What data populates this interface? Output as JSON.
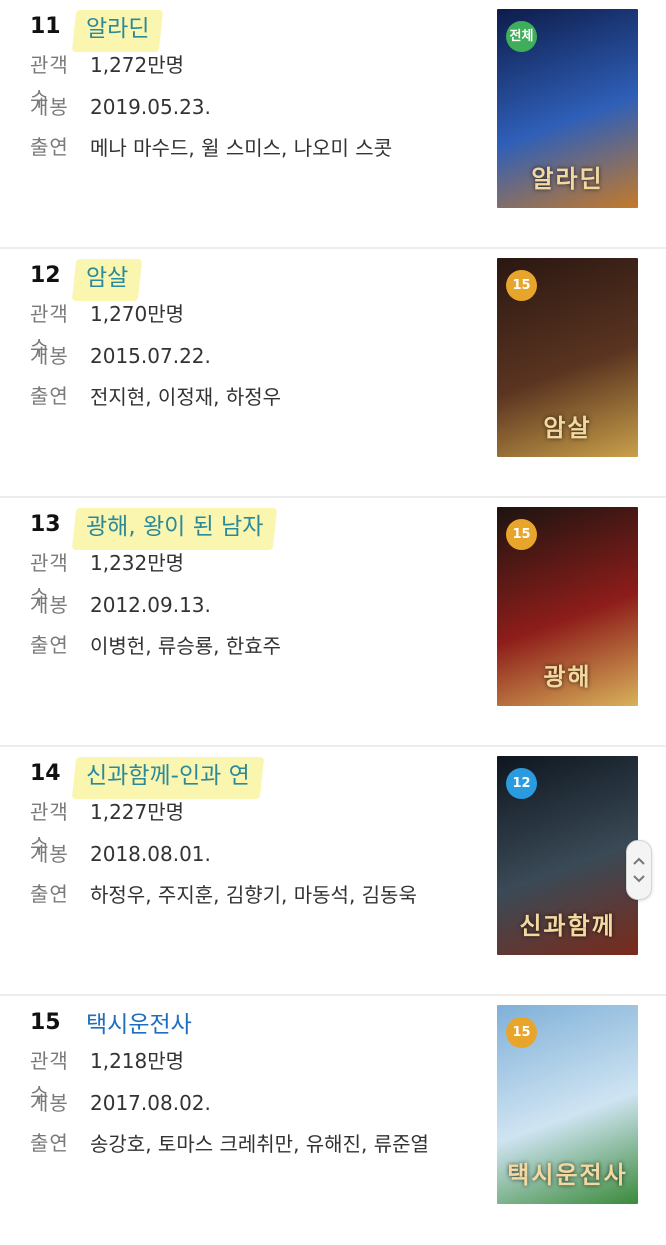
{
  "labels": {
    "audience": "관객수",
    "release": "개봉",
    "cast": "출연"
  },
  "movies": [
    {
      "rank": "11",
      "title": "알라딘",
      "highlighted": true,
      "audience": "1,272만명",
      "release": "2019.05.23.",
      "cast": "메나 마수드, 윌 스미스, 나오미 스콧",
      "rating": "전체",
      "rating_color": "#3fae5a",
      "poster_text": "알라딘",
      "poster_colors": [
        "#0d1c4a",
        "#2f5fb8",
        "#c47a2a"
      ]
    },
    {
      "rank": "12",
      "title": "암살",
      "highlighted": true,
      "audience": "1,270만명",
      "release": "2015.07.22.",
      "cast": "전지현, 이정재, 하정우",
      "rating": "15",
      "rating_color": "#e8a52c",
      "poster_text": "암살",
      "poster_colors": [
        "#2a1712",
        "#5a3420",
        "#c9a04a"
      ]
    },
    {
      "rank": "13",
      "title": "광해, 왕이 된 남자",
      "highlighted": true,
      "audience": "1,232만명",
      "release": "2012.09.13.",
      "cast": "이병헌, 류승룡, 한효주",
      "rating": "15",
      "rating_color": "#e8a52c",
      "poster_text": "광해",
      "poster_colors": [
        "#1b1410",
        "#8e1d1a",
        "#d8b25a"
      ]
    },
    {
      "rank": "14",
      "title": "신과함께-인과 연",
      "highlighted": true,
      "audience": "1,227만명",
      "release": "2018.08.01.",
      "cast": "하정우, 주지훈, 김향기, 마동석, 김동욱",
      "rating": "12",
      "rating_color": "#2b9be0",
      "poster_text": "신과함께",
      "poster_colors": [
        "#0e1620",
        "#3a4a56",
        "#7a2a1a"
      ]
    },
    {
      "rank": "15",
      "title": "택시운전사",
      "highlighted": false,
      "audience": "1,218만명",
      "release": "2017.08.02.",
      "cast": "송강호, 토마스 크레취만, 유해진, 류준열",
      "rating": "15",
      "rating_color": "#e8a52c",
      "poster_text": "택시운전사",
      "poster_colors": [
        "#7fb0d8",
        "#cfe4f2",
        "#3a8a3a"
      ]
    }
  ]
}
